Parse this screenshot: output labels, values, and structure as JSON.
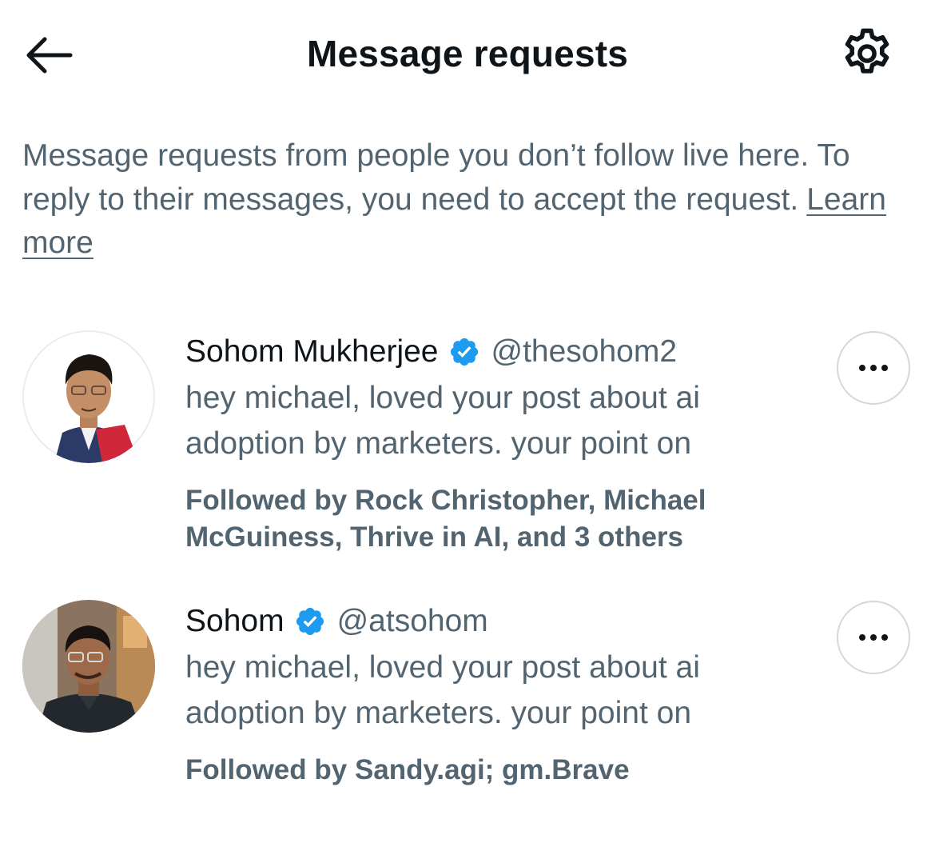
{
  "header": {
    "title": "Message requests",
    "back_icon": "arrow-left-icon",
    "settings_icon": "gear-icon"
  },
  "intro": {
    "text": "Message requests from people you don’t follow live here. To reply to their messages, you need to accept the request.",
    "learn_more": "Learn more"
  },
  "colors": {
    "text_primary": "#0f1419",
    "text_secondary": "#536471",
    "verified_blue": "#1d9bf0",
    "border": "#cfd9de"
  },
  "requests": [
    {
      "name": "Sohom Mukherjee",
      "verified": true,
      "handle": "@thesohom2",
      "preview": "hey michael, loved your post about ai adoption by marketers. your point on",
      "followed_by": "Followed by Rock Christopher, Michael McGuiness, Thrive in AI, and 3 others"
    },
    {
      "name": "Sohom",
      "verified": true,
      "handle": "@atsohom",
      "preview": "hey michael, loved your post about ai adoption by marketers. your point on",
      "followed_by": "Followed by Sandy.agi; gm.Brave"
    }
  ]
}
